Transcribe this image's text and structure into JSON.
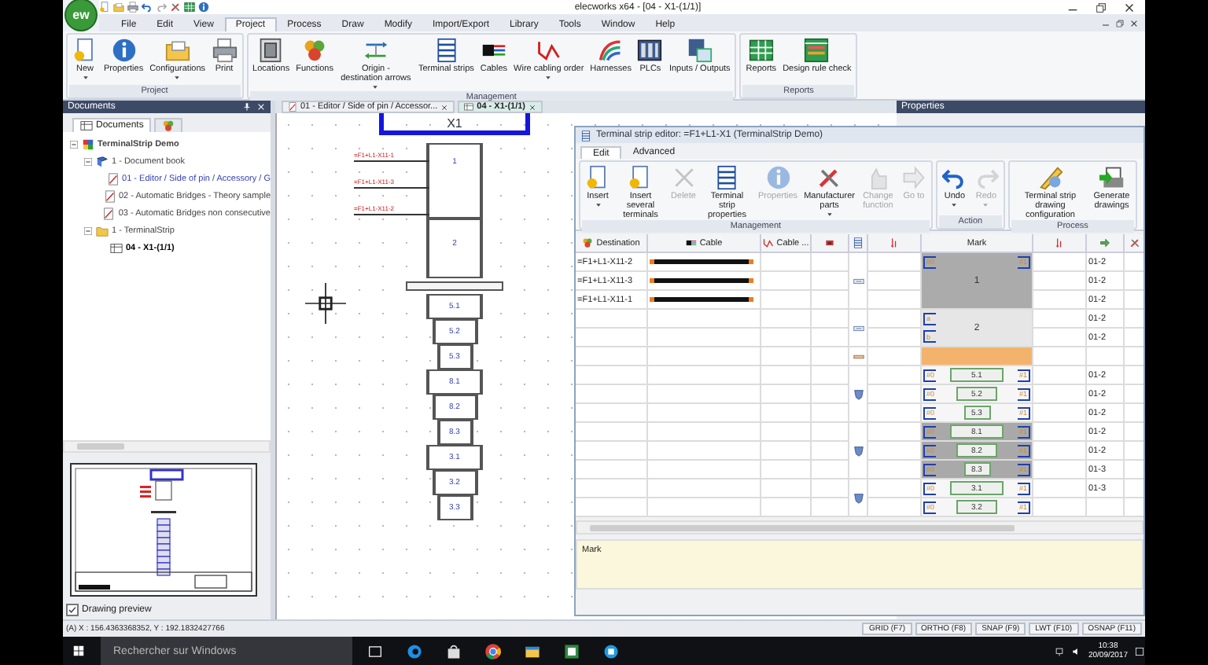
{
  "app": {
    "logo": "ew",
    "title": "elecworks x64 - [04 - X1-(1/1)]"
  },
  "menu": [
    {
      "label": "File",
      "selected": false
    },
    {
      "label": "Edit",
      "selected": false
    },
    {
      "label": "View",
      "selected": false
    },
    {
      "label": "Project",
      "selected": true
    },
    {
      "label": "Process",
      "selected": false
    },
    {
      "label": "Draw",
      "selected": false
    },
    {
      "label": "Modify",
      "selected": false
    },
    {
      "label": "Import/Export",
      "selected": false
    },
    {
      "label": "Library",
      "selected": false
    },
    {
      "label": "Tools",
      "selected": false
    },
    {
      "label": "Window",
      "selected": false
    },
    {
      "label": "Help",
      "selected": false
    }
  ],
  "ribbon": [
    {
      "group": "Project",
      "buttons": [
        {
          "label": "New",
          "dropdown": true,
          "disabled": false
        },
        {
          "label": "Properties",
          "dropdown": false,
          "disabled": false
        },
        {
          "label": "Configurations",
          "dropdown": true,
          "disabled": false
        },
        {
          "label": "Print",
          "dropdown": false,
          "disabled": false
        }
      ]
    },
    {
      "group": "Management",
      "buttons": [
        {
          "label": "Locations",
          "dropdown": false,
          "disabled": false
        },
        {
          "label": "Functions",
          "dropdown": false,
          "disabled": false
        },
        {
          "label": "Origin - destination arrows",
          "dropdown": true,
          "disabled": false
        },
        {
          "label": "Terminal strips",
          "dropdown": false,
          "disabled": false
        },
        {
          "label": "Cables",
          "dropdown": false,
          "disabled": false
        },
        {
          "label": "Wire cabling order",
          "dropdown": true,
          "disabled": false
        },
        {
          "label": "Harnesses",
          "dropdown": false,
          "disabled": false
        },
        {
          "label": "PLCs",
          "dropdown": false,
          "disabled": false
        },
        {
          "label": "Inputs / Outputs",
          "dropdown": false,
          "disabled": false
        }
      ]
    },
    {
      "group": "Reports",
      "buttons": [
        {
          "label": "Reports",
          "dropdown": false,
          "disabled": false
        },
        {
          "label": "Design rule check",
          "dropdown": false,
          "disabled": false
        }
      ]
    }
  ],
  "documents": {
    "title": "Documents",
    "tabs": [
      {
        "label": "Documents",
        "selected": true
      },
      {
        "selected": false
      }
    ],
    "tree": [
      {
        "label": "TerminalStrip Demo",
        "kind": "project",
        "expanded": true,
        "selected": false,
        "open": false,
        "children": [
          {
            "label": "1 - Document book",
            "kind": "book",
            "expanded": true,
            "selected": false,
            "open": false,
            "children": [
              {
                "label": "01 - Editor / Side of pin / Accessory / G",
                "kind": "page",
                "selected": false,
                "open": true
              },
              {
                "label": "02 - Automatic Bridges - Theory sample",
                "kind": "page",
                "selected": false,
                "open": false
              },
              {
                "label": "03 - Automatic Bridges non consecutive",
                "kind": "page",
                "selected": false,
                "open": false
              }
            ]
          },
          {
            "label": "1 - TerminalStrip",
            "kind": "folder",
            "expanded": true,
            "selected": false,
            "open": false,
            "children": [
              {
                "label": "04 - X1-(1/1)",
                "kind": "sheet",
                "selected": true,
                "open": false
              }
            ]
          }
        ]
      }
    ],
    "preview": {
      "label": "Drawing preview",
      "checked": true
    }
  },
  "doc_tabs": [
    {
      "label": "01 - Editor / Side of pin / Accessor...",
      "selected": false
    },
    {
      "label": "04 - X1-(1/1)",
      "selected": true
    }
  ],
  "drawing": {
    "title": "X1",
    "connections": [
      "=F1+L1-X11-1",
      "=F1+L1-X11-3",
      "=F1+L1-X11-2"
    ],
    "terminals": [
      {
        "label": "1",
        "kind": "tall"
      },
      {
        "label": "2",
        "kind": "medium"
      },
      {
        "kind": "plate"
      },
      {
        "label": "5.1",
        "kind": "top"
      },
      {
        "label": "5.2",
        "kind": "middle"
      },
      {
        "label": "5.3",
        "kind": "bottom"
      },
      {
        "label": "8.1",
        "kind": "top"
      },
      {
        "label": "8.2",
        "kind": "middle"
      },
      {
        "label": "8.3",
        "kind": "bottom"
      },
      {
        "label": "3.1",
        "kind": "top"
      },
      {
        "label": "3.2",
        "kind": "middle"
      },
      {
        "label": "3.3",
        "kind": "bottom"
      }
    ]
  },
  "properties": {
    "title": "Properties"
  },
  "editor": {
    "title": "Terminal strip editor: =F1+L1-X1 (TerminalStrip Demo)",
    "tabs": [
      {
        "label": "Edit",
        "selected": true
      },
      {
        "label": "Advanced",
        "selected": false
      }
    ],
    "ribbon": [
      {
        "group": "Management",
        "buttons": [
          {
            "label": "Insert",
            "dropdown": true,
            "disabled": false
          },
          {
            "label": "Insert several terminals",
            "dropdown": false,
            "disabled": false
          },
          {
            "label": "Delete",
            "dropdown": false,
            "disabled": true
          },
          {
            "label": "Terminal strip properties",
            "dropdown": false,
            "disabled": false
          },
          {
            "label": "Properties",
            "dropdown": false,
            "disabled": true
          },
          {
            "label": "Manufacturer parts",
            "dropdown": true,
            "disabled": false
          },
          {
            "label": "Change function",
            "dropdown": false,
            "disabled": true
          },
          {
            "label": "Go to",
            "dropdown": false,
            "disabled": true
          }
        ]
      },
      {
        "group": "Action",
        "buttons": [
          {
            "label": "Undo",
            "dropdown": true,
            "disabled": false
          },
          {
            "label": "Redo",
            "dropdown": true,
            "disabled": true
          }
        ]
      },
      {
        "group": "Process",
        "buttons": [
          {
            "label": "Terminal strip drawing configuration",
            "dropdown": false,
            "disabled": false
          },
          {
            "label": "Generate drawings",
            "dropdown": false,
            "disabled": false
          }
        ]
      }
    ],
    "columns": [
      {
        "label": "Destination"
      },
      {
        "label": "Cable"
      },
      {
        "label": "Cable ..."
      },
      {},
      {},
      {},
      {
        "label": "Mark"
      },
      {},
      {},
      {}
    ],
    "groups": [
      {
        "kind": "single",
        "selected": true,
        "mark": "1",
        "lines": [
          {
            "destination": "=F1+L1-X11-2",
            "cable": true,
            "mark_left": "#0",
            "mark_right": "#1",
            "ref": "01-2"
          },
          {
            "destination": "=F1+L1-X11-3",
            "cable": true,
            "ref": "01-2"
          },
          {
            "destination": "=F1+L1-X11-1",
            "cable": true,
            "ref": "01-2"
          }
        ]
      },
      {
        "kind": "single",
        "selected": false,
        "mark": "2",
        "lines": [
          {
            "cable": false,
            "mark_left": "a",
            "ref": "01-2"
          },
          {
            "cable": false,
            "mark_left": "b",
            "ref": "01-2"
          }
        ]
      },
      {
        "kind": "separator",
        "selected": false
      },
      {
        "kind": "level",
        "selected": false,
        "lines": [
          {
            "cable": false,
            "mark": "5.1",
            "mark_left": "#0",
            "mark_right": "#1",
            "ref": "01-2"
          },
          {
            "cable": false,
            "mark": "5.2",
            "mark_left": "#0",
            "mark_right": "#1",
            "ref": "01-2"
          },
          {
            "cable": false,
            "mark": "5.3",
            "mark_left": "#0",
            "mark_right": "#1",
            "ref": "01-2"
          }
        ]
      },
      {
        "kind": "level",
        "selected": true,
        "lines": [
          {
            "cable": false,
            "mark": "8.1",
            "mark_left": "#0",
            "mark_right": "#1",
            "ref": "01-2"
          },
          {
            "cable": false,
            "mark": "8.2",
            "mark_left": "#0",
            "mark_right": "#1",
            "ref": "01-2"
          },
          {
            "cable": false,
            "mark": "8.3",
            "mark_left": "#0",
            "mark_right": "#1",
            "ref": "01-3"
          }
        ]
      },
      {
        "kind": "level",
        "selected": false,
        "lines": [
          {
            "cable": false,
            "mark": "3.1",
            "mark_left": "#0",
            "mark_right": "#1",
            "ref": "01-3"
          },
          {
            "cable": false,
            "mark": "3.2",
            "mark_left": "#0",
            "mark_right": "#1"
          }
        ]
      }
    ],
    "description": "Mark"
  },
  "status": {
    "coordinates": "(A) X : 156.4363368352, Y : 192.1832427766",
    "toggles": [
      "GRID (F7)",
      "ORTHO (F8)",
      "SNAP (F9)",
      "LWT (F10)",
      "OSNAP (F11)"
    ]
  },
  "taskbar": {
    "search": {
      "placeholder": "Rechercher sur Windows"
    },
    "time": "10:38",
    "date": "20/09/2017"
  }
}
